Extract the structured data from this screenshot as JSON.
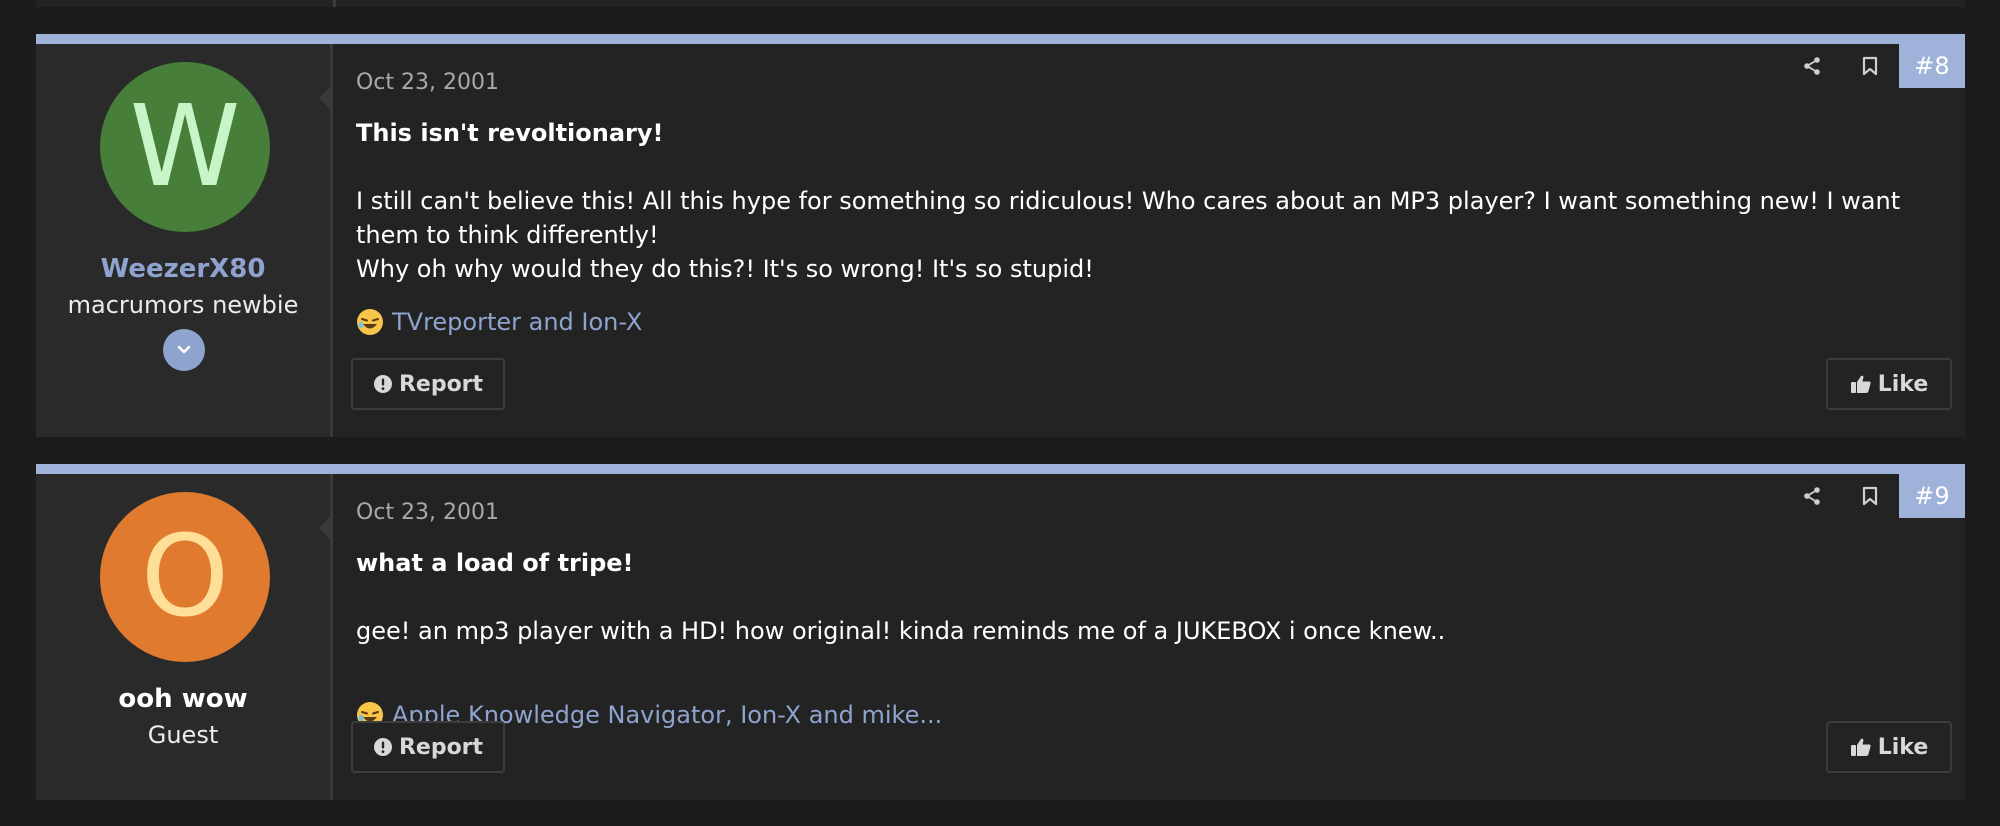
{
  "posts": [
    {
      "date": "Oct 23, 2001",
      "number": "#8",
      "author": {
        "initial": "W",
        "name": "WeezerX80",
        "title": "macrumors newbie",
        "avatar_bg": "#467e3a",
        "avatar_fg": "#c8f5c8",
        "name_color": "#8fa3cf"
      },
      "headline": "This isn't revoltionary!",
      "body": [
        "I still can't believe this! All this hype for something so ridiculous! Who cares about an MP3 player? I want something new! I want them to think differently!",
        "Why oh why would they do this?! It's so wrong! It's so stupid!"
      ],
      "reaction_icon": "laughing-emoji-icon",
      "reactions": "TVreporter and Ion-X",
      "report_label": "Report",
      "like_label": "Like"
    },
    {
      "date": "Oct 23, 2001",
      "number": "#9",
      "author": {
        "initial": "O",
        "name": "ooh wow",
        "title": "Guest",
        "avatar_bg": "#e07a2e",
        "avatar_fg": "#ffdf98",
        "name_color": "#ffffff"
      },
      "headline": "what a load of tripe!",
      "body": [
        "gee! an mp3 player with a HD! how original! kinda reminds me of a JUKEBOX i once knew.."
      ],
      "reaction_icon": "laughing-emoji-icon",
      "reactions": "Apple Knowledge Navigator, Ion-X and mike...",
      "report_label": "Report",
      "like_label": "Like"
    }
  ],
  "colors": {
    "accent": "#9fb2d9",
    "link": "#8fa3cf",
    "background": "#1c1c1c",
    "post_bg": "#232323",
    "user_cell_bg": "#2a2a2a"
  }
}
